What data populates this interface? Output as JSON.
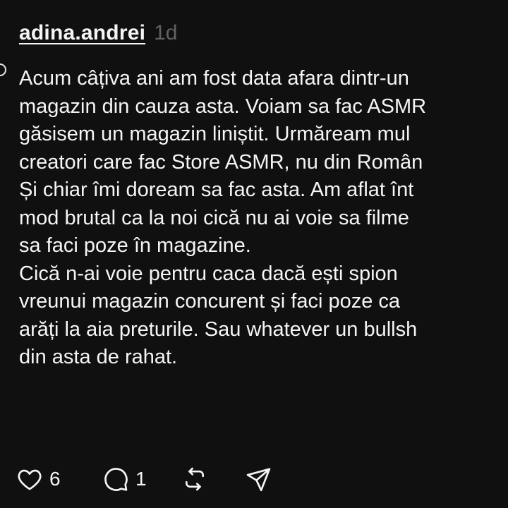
{
  "post": {
    "username": "adina.andrei",
    "timestamp": "1d",
    "lines": [
      "Acum câțiva ani am fost data afara dintr-un",
      "magazin din cauza asta. Voiam sa fac ASMR",
      "găsisem un magazin liniștit. Urmăream mul",
      "creatori care fac Store ASMR, nu din Român",
      "Și chiar îmi doream sa fac asta. Am aflat înt",
      "mod brutal ca la noi cică nu ai voie sa filme",
      "sa faci poze în magazine.",
      "Cică n-ai voie pentru caca dacă ești spion",
      "vreunui magazin concurent și faci poze ca",
      "arăți la aia preturile. Sau whatever un bullsh",
      "din asta de rahat."
    ]
  },
  "actions": {
    "like": {
      "icon": "heart-icon",
      "count": "6"
    },
    "reply": {
      "icon": "speech-bubble-icon",
      "count": "1"
    },
    "repost": {
      "icon": "repost-arrows-icon"
    },
    "share": {
      "icon": "paper-plane-icon"
    }
  },
  "colors": {
    "background": "#101010",
    "text": "#f3f5f7",
    "muted": "#616161"
  }
}
